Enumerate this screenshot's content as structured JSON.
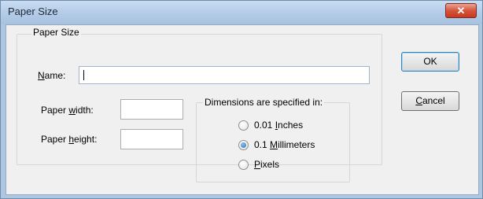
{
  "window": {
    "title": "Paper Size",
    "close_glyph": "✕"
  },
  "group": {
    "title": "Paper Size"
  },
  "name": {
    "label_mnemonic": "N",
    "label_rest": "ame:",
    "value": ""
  },
  "paper_width": {
    "label_pre": "Paper ",
    "label_mnemonic": "w",
    "label_rest": "idth:",
    "value": ""
  },
  "paper_height": {
    "label_pre": "Paper ",
    "label_mnemonic": "h",
    "label_rest": "eight:",
    "value": ""
  },
  "dimensions": {
    "title": "Dimensions are specified in:",
    "selected": "0.1 Millimeters",
    "options": [
      {
        "pre": "0.01 ",
        "mnemonic": "I",
        "rest": "nches"
      },
      {
        "pre": "0.1 ",
        "mnemonic": "M",
        "rest": "illimeters"
      },
      {
        "pre": "",
        "mnemonic": "P",
        "rest": "ixels"
      }
    ]
  },
  "buttons": {
    "ok_label": "OK",
    "cancel_mnemonic": "C",
    "cancel_rest": "ancel"
  },
  "colors": {
    "title_bar": "#b3cbe7",
    "client_bg": "#f0f0f0",
    "close_button": "#d6553d",
    "radio_dot": "#2d6fb4"
  }
}
